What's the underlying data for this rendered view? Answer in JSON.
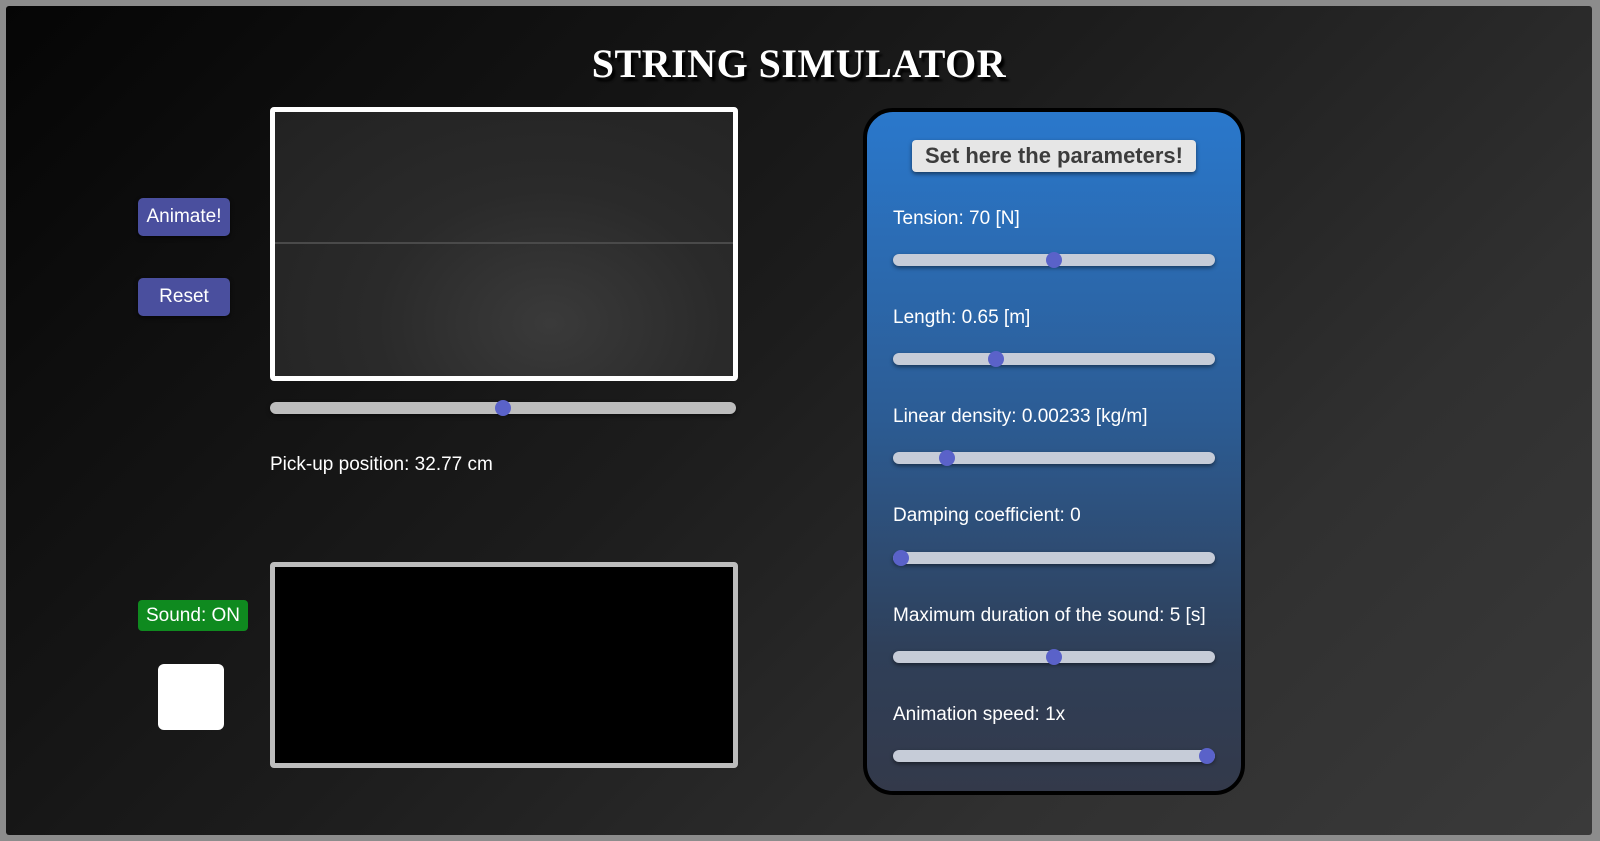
{
  "title": "STRING SIMULATOR",
  "controls": {
    "animate_label": "Animate!",
    "reset_label": "Reset",
    "sound_label": "Sound: ON",
    "sound_color": "#0f8a1f",
    "string_color": "#ffffff"
  },
  "pickup": {
    "label": "Pick-up position: 32.77 cm",
    "value_fraction": 0.5
  },
  "panel": {
    "heading": "Set here the parameters!",
    "params": [
      {
        "label": "Tension: 70 [N]",
        "value_fraction": 0.5
      },
      {
        "label": "Length: 0.65 [m]",
        "value_fraction": 0.31
      },
      {
        "label": "Linear density: 0.00233 [kg/m]",
        "value_fraction": 0.15
      },
      {
        "label": "Damping coefficient: 0",
        "value_fraction": 0.0
      },
      {
        "label": "Maximum duration of the sound: 5 [s]",
        "value_fraction": 0.5
      },
      {
        "label": "Animation speed: 1x",
        "value_fraction": 1.0
      }
    ]
  },
  "colors": {
    "accent": "#5a62c9",
    "panel_top": "#2a78cc",
    "panel_bottom": "#33394a",
    "button": "#4a4f9e"
  }
}
